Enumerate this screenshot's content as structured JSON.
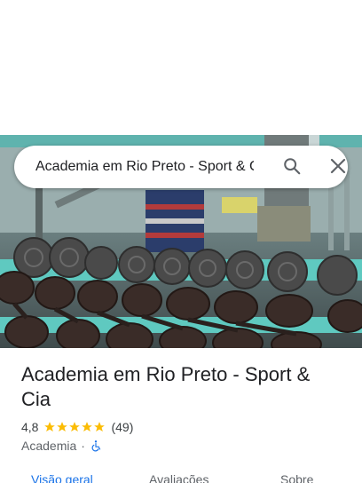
{
  "search": {
    "query": "Academia em Rio Preto - Sport & Cia",
    "search_icon": "search-icon",
    "close_icon": "close-icon"
  },
  "place": {
    "title": "Academia em Rio Preto - Sport & Cia",
    "rating": "4,8",
    "stars": 5,
    "reviews": "(49)",
    "category": "Academia",
    "separator": "·",
    "accessibility_icon": "wheelchair-icon"
  },
  "tabs": [
    {
      "label": "Visão geral"
    },
    {
      "label": "Avaliações"
    },
    {
      "label": "Sobre"
    }
  ],
  "colors": {
    "accent": "#1a73e8",
    "star": "#fbbc04",
    "text": "#202124",
    "secondary": "#5f6368"
  }
}
